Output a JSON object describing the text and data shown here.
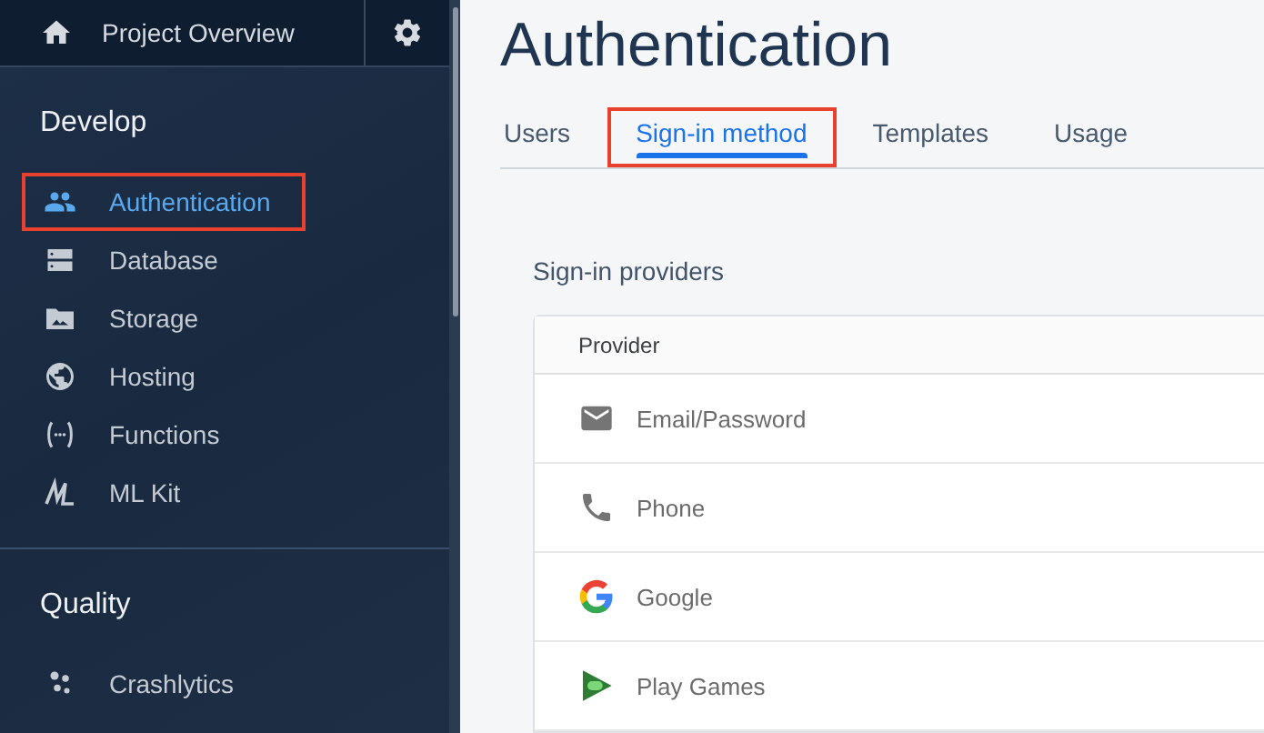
{
  "sidebar": {
    "project": "Project Overview",
    "sections": [
      {
        "title": "Develop",
        "items": [
          {
            "label": "Authentication",
            "selected": true,
            "highlighted": true
          },
          {
            "label": "Database",
            "selected": false,
            "highlighted": false
          },
          {
            "label": "Storage",
            "selected": false,
            "highlighted": false
          },
          {
            "label": "Hosting",
            "selected": false,
            "highlighted": false
          },
          {
            "label": "Functions",
            "selected": false,
            "highlighted": false
          },
          {
            "label": "ML Kit",
            "selected": false,
            "highlighted": false
          }
        ]
      },
      {
        "title": "Quality",
        "items": [
          {
            "label": "Crashlytics",
            "selected": false,
            "highlighted": false
          }
        ]
      }
    ]
  },
  "page_title": "Authentication",
  "tabs": [
    {
      "label": "Users",
      "selected": false,
      "highlighted": false
    },
    {
      "label": "Sign-in method",
      "selected": true,
      "highlighted": true
    },
    {
      "label": "Templates",
      "selected": false,
      "highlighted": false
    },
    {
      "label": "Usage",
      "selected": false,
      "highlighted": false
    }
  ],
  "section_title": "Sign-in providers",
  "table": {
    "columns": [
      "Provider"
    ],
    "rows": [
      "Email/Password",
      "Phone",
      "Google",
      "Play Games"
    ]
  }
}
